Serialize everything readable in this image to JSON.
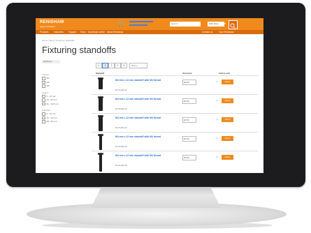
{
  "header": {
    "logo": "RENISHAW",
    "logo_sub": "apply innovation",
    "cart_icon": "cart-icon",
    "search_placeholder": "Search",
    "language": "Web shop",
    "search_icon": "search-icon"
  },
  "nav": {
    "items": [
      "Products",
      "Industries",
      "Support",
      "Shop",
      "Download centre",
      "About Renishaw"
    ],
    "right_items": [
      "Contact us",
      "Your Renishaw"
    ]
  },
  "breadcrumb": "Home  /  Shop  /  Fixturing  /  Standoffs",
  "page": {
    "title": "Fixturing standoffs",
    "filter_label": "Refine by"
  },
  "pager": {
    "pages": [
      "1",
      "2",
      "3",
      "4",
      "5"
    ],
    "active": "2",
    "next_label": "Next »"
  },
  "sidebar": {
    "groups": [
      {
        "heading": "Thread",
        "options": [
          "M4",
          "M6",
          "M8"
        ]
      },
      {
        "heading": "Height",
        "options": [
          "5 - 10 mm",
          "10 - 50 mm",
          "50 - 100 mm"
        ]
      },
      {
        "heading": "Diameter",
        "options": [
          "6 - 10 mm",
          "10 - 20 mm",
          "20 - 30 mm"
        ]
      }
    ]
  },
  "table": {
    "columns": {
      "product": "Standoff",
      "price": "Unit price",
      "add": "Add to cart"
    },
    "rows": [
      {
        "desc": "M4 mm x 12 mm standoff with M4 thread",
        "sku": "R-CS-M4-12",
        "price": "£9.60",
        "qty": "1",
        "add": "Add ▸"
      },
      {
        "desc": "M4 mm x 12 mm standoff with M4 thread",
        "sku": "R-CS-M4-12",
        "price": "£9.60",
        "qty": "1",
        "add": "Add ▸"
      },
      {
        "desc": "M4 mm x 12 mm standoff with M4 thread",
        "sku": "R-CS-M4-12",
        "price": "£9.60",
        "qty": "1",
        "add": "Add ▸"
      },
      {
        "desc": "M4 mm x 12 mm standoff with M4 thread",
        "sku": "R-CS-M4-12",
        "price": "£9.60",
        "qty": "1",
        "add": "Add ▸"
      },
      {
        "desc": "M4 mm x 12 mm standoff with M4 thread",
        "sku": "R-CS-M4-12",
        "price": "£9.60",
        "qty": "1",
        "add": "Add ▸"
      }
    ]
  },
  "colors": {
    "accent": "#f08a1c",
    "nav": "#d96b0f",
    "link": "#2a6fd6"
  }
}
